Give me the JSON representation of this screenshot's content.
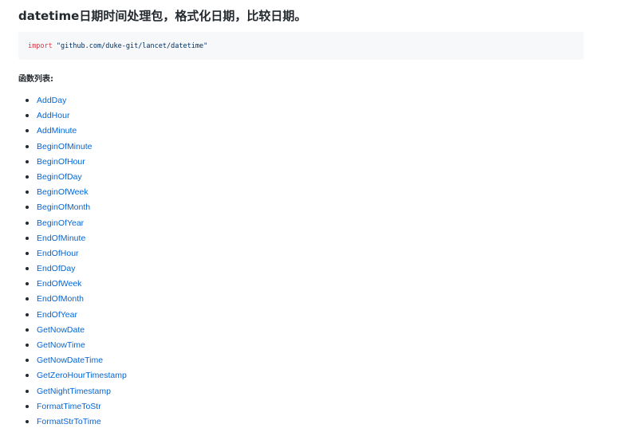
{
  "title": "datetime日期时间处理包，格式化日期，比较日期。",
  "code": {
    "keyword": "import",
    "string": "\"github.com/duke-git/lancet/datetime\""
  },
  "section_label": "函数列表:",
  "functions": [
    "AddDay",
    "AddHour",
    "AddMinute",
    "BeginOfMinute",
    "BeginOfHour",
    "BeginOfDay",
    "BeginOfWeek",
    "BeginOfMonth",
    "BeginOfYear",
    "EndOfMinute",
    "EndOfHour",
    "EndOfDay",
    "EndOfWeek",
    "EndOfMonth",
    "EndOfYear",
    "GetNowDate",
    "GetNowTime",
    "GetNowDateTime",
    "GetZeroHourTimestamp",
    "GetNightTimestamp",
    "FormatTimeToStr",
    "FormatStrToTime"
  ],
  "colors": {
    "link": "#0366d6",
    "keyword": "#d73a49",
    "string": "#032f62",
    "code_background": "#f6f8fa"
  }
}
